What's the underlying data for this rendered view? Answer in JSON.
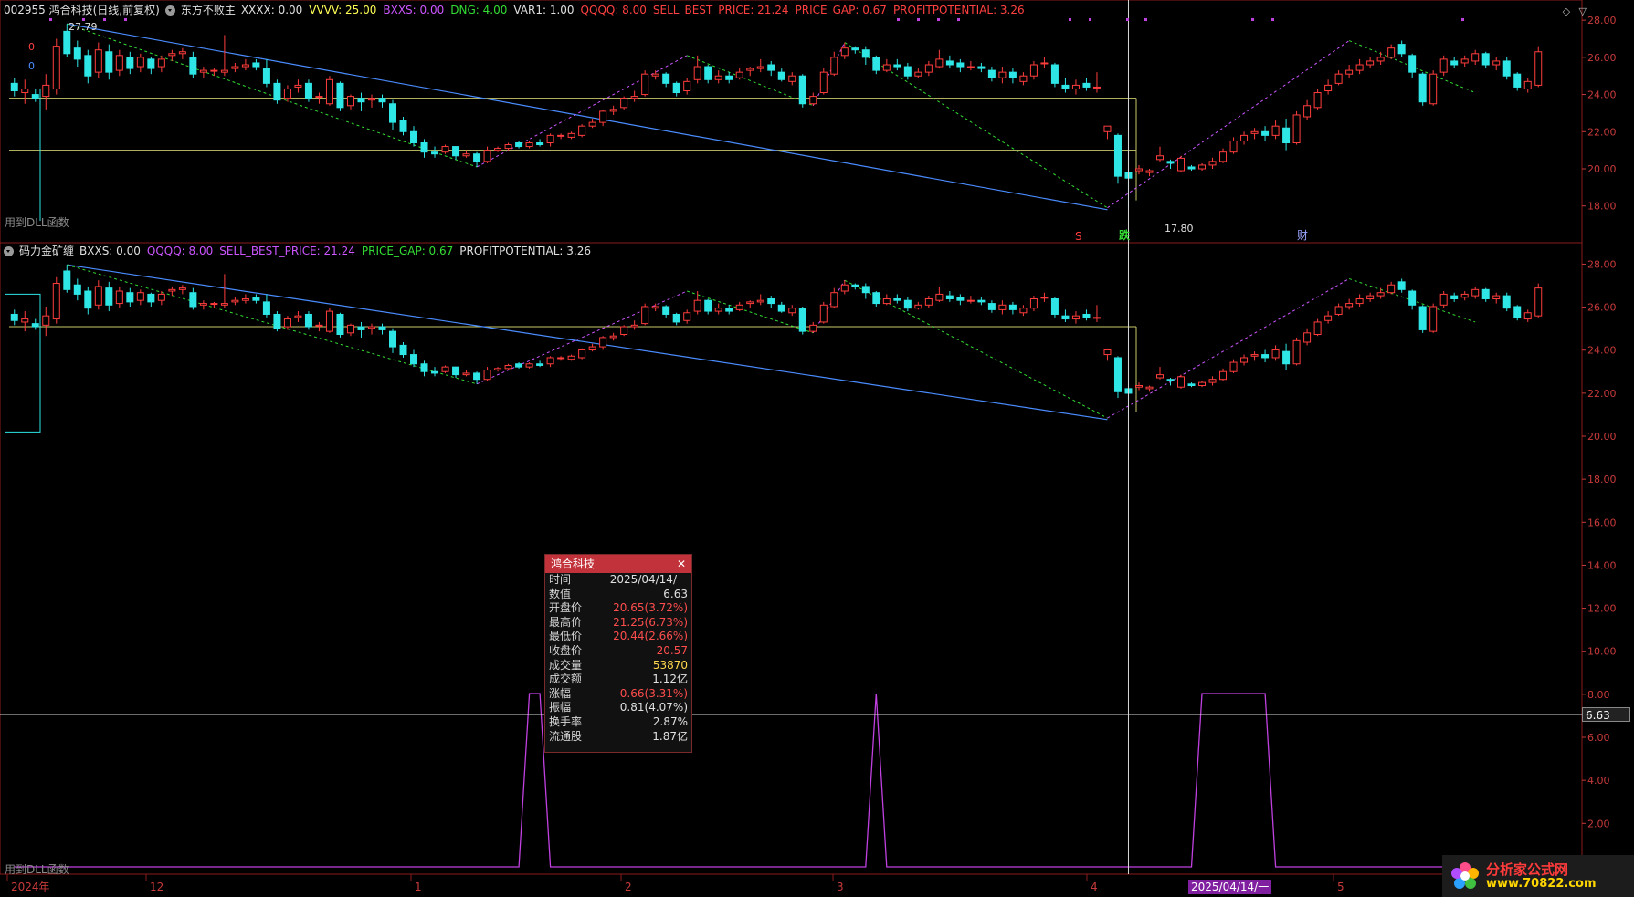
{
  "panel1": {
    "header": "002955 鸿合科技(日线,前复权)",
    "indicator_name": "东方不败主",
    "params": [
      {
        "label": "XXXX:",
        "value": "0.00",
        "color": "#e0e0e0"
      },
      {
        "label": "VVVV:",
        "value": "25.00",
        "color": "#ffff55"
      },
      {
        "label": "BXXS:",
        "value": "0.00",
        "color": "#cc55ff"
      },
      {
        "label": "DNG:",
        "value": "4.00",
        "color": "#33dd33"
      },
      {
        "label": "VAR1:",
        "value": "1.00",
        "color": "#e0e0e0"
      },
      {
        "label": "QQQQ:",
        "value": "8.00",
        "color": "#ff4040"
      },
      {
        "label": "SELL_BEST_PRICE:",
        "value": "21.24",
        "color": "#ff4040"
      },
      {
        "label": "PRICE_GAP:",
        "value": "0.67",
        "color": "#ff4040"
      },
      {
        "label": "PROFITPOTENTIAL:",
        "value": "3.26",
        "color": "#ff4040"
      }
    ],
    "high_label": "27.79",
    "low_label": "17.80",
    "zero_labels": [
      "0",
      "0"
    ],
    "dll_text": "用到DLL函数",
    "marker_s": "S",
    "marker_die": "跌",
    "marker_cai": "财",
    "tool_icons": [
      "◇",
      "▽"
    ],
    "y_labels": [
      "28.00",
      "26.00",
      "24.00",
      "22.00",
      "20.00",
      "18.00"
    ]
  },
  "panel2": {
    "indicator_name": "码力金矿缠",
    "params": [
      {
        "label": "BXXS:",
        "value": "0.00",
        "color": "#e0e0e0"
      },
      {
        "label": "QQQQ:",
        "value": "8.00",
        "color": "#cc55ff"
      },
      {
        "label": "SELL_BEST_PRICE:",
        "value": "21.24",
        "color": "#cc55ff"
      },
      {
        "label": "PRICE_GAP:",
        "value": "0.67",
        "color": "#33dd33"
      },
      {
        "label": "PROFITPOTENTIAL:",
        "value": "3.26",
        "color": "#e0e0e0"
      }
    ],
    "y_labels": [
      "28.00",
      "26.00",
      "24.00",
      "22.00",
      "20.00",
      "18.00",
      "16.00",
      "14.00",
      "12.00",
      "10.00",
      "8.00",
      "6.00",
      "4.00",
      "2.00"
    ],
    "dll_text": "用到DLL函数",
    "cursor_value": "6.63"
  },
  "x_axis": {
    "labels": [
      "2024年",
      "12",
      "1",
      "2",
      "3",
      "4",
      "5"
    ],
    "cursor_date": "2025/04/14/一"
  },
  "tooltip": {
    "title": "鸿合科技",
    "rows": [
      {
        "k": "时间",
        "v": "2025/04/14/一",
        "c": "#e0e0e0"
      },
      {
        "k": "数值",
        "v": "6.63",
        "c": "#e0e0e0"
      },
      {
        "k": "开盘价",
        "v": "20.65(3.72%)",
        "c": "#ff4d4d"
      },
      {
        "k": "最高价",
        "v": "21.25(6.73%)",
        "c": "#ff4d4d"
      },
      {
        "k": "最低价",
        "v": "20.44(2.66%)",
        "c": "#ff4d4d"
      },
      {
        "k": "收盘价",
        "v": "20.57",
        "c": "#ff4d4d"
      },
      {
        "k": "成交量",
        "v": "53870",
        "c": "#ffd84d"
      },
      {
        "k": "成交额",
        "v": "1.12亿",
        "c": "#e0e0e0"
      },
      {
        "k": "涨幅",
        "v": "0.66(3.31%)",
        "c": "#ff4d4d"
      },
      {
        "k": "振幅",
        "v": "0.81(4.07%)",
        "c": "#e0e0e0"
      },
      {
        "k": "换手率",
        "v": "2.87%",
        "c": "#e0e0e0"
      },
      {
        "k": "流通股",
        "v": "1.87亿",
        "c": "#e0e0e0"
      }
    ]
  },
  "logo": {
    "title": "分析家公式网",
    "url": "www.70822.com"
  },
  "chart_data": {
    "type": "candlestick",
    "price_range": [
      17.2,
      28.4
    ],
    "indicator_range": [
      0,
      8
    ],
    "candles": [
      [
        24.6,
        24.2,
        24.9,
        23.9
      ],
      [
        24.1,
        24.3,
        24.8,
        23.5
      ],
      [
        24.0,
        23.8,
        24.3,
        23.6
      ],
      [
        23.9,
        24.5,
        25.1,
        23.2
      ],
      [
        24.3,
        26.6,
        27.0,
        24.0
      ],
      [
        27.4,
        26.2,
        27.8,
        26.0
      ],
      [
        26.5,
        25.9,
        26.9,
        25.5
      ],
      [
        26.1,
        25.0,
        26.4,
        24.6
      ],
      [
        25.2,
        26.4,
        26.8,
        24.9
      ],
      [
        26.3,
        25.2,
        26.7,
        24.8
      ],
      [
        25.3,
        26.1,
        26.4,
        25.0
      ],
      [
        26.0,
        25.4,
        26.3,
        25.1
      ],
      [
        25.5,
        26.0,
        26.2,
        25.2
      ],
      [
        25.9,
        25.4,
        26.0,
        25.1
      ],
      [
        25.5,
        25.9,
        26.1,
        25.2
      ],
      [
        26.1,
        26.2,
        26.4,
        25.8
      ],
      [
        26.2,
        26.3,
        26.5,
        25.9
      ],
      [
        26.0,
        25.1,
        26.3,
        24.9
      ],
      [
        25.2,
        25.3,
        25.5,
        24.9
      ],
      [
        25.3,
        25.3,
        25.4,
        25.0
      ],
      [
        25.2,
        25.3,
        27.2,
        25.0
      ],
      [
        25.4,
        25.5,
        25.7,
        25.2
      ],
      [
        25.5,
        25.6,
        25.9,
        25.3
      ],
      [
        25.7,
        25.5,
        25.9,
        25.3
      ],
      [
        25.4,
        24.6,
        25.9,
        24.4
      ],
      [
        24.6,
        23.7,
        24.8,
        23.5
      ],
      [
        23.8,
        24.3,
        24.5,
        23.6
      ],
      [
        24.4,
        24.5,
        24.8,
        24.1
      ],
      [
        24.6,
        23.8,
        24.8,
        23.6
      ],
      [
        23.9,
        23.9,
        24.1,
        23.5
      ],
      [
        23.5,
        24.8,
        25.0,
        23.4
      ],
      [
        24.6,
        23.3,
        24.7,
        23.1
      ],
      [
        23.4,
        23.9,
        24.0,
        23.2
      ],
      [
        23.8,
        23.6,
        24.1,
        23.1
      ],
      [
        23.7,
        23.8,
        24.0,
        23.3
      ],
      [
        23.8,
        23.6,
        24.0,
        23.3
      ],
      [
        23.5,
        22.5,
        23.7,
        22.1
      ],
      [
        22.6,
        22.0,
        22.8,
        21.8
      ],
      [
        22.0,
        21.4,
        22.3,
        21.2
      ],
      [
        21.4,
        20.9,
        21.6,
        20.6
      ],
      [
        20.9,
        20.8,
        21.2,
        20.6
      ],
      [
        20.9,
        21.2,
        21.3,
        20.8
      ],
      [
        21.2,
        20.7,
        21.2,
        20.5
      ],
      [
        20.7,
        20.8,
        21.0,
        20.6
      ],
      [
        20.8,
        20.4,
        20.9,
        20.1
      ],
      [
        20.4,
        21.0,
        21.2,
        20.3
      ],
      [
        21.0,
        21.1,
        21.2,
        20.9
      ],
      [
        21.1,
        21.3,
        21.4,
        21.0
      ],
      [
        21.4,
        21.2,
        21.5,
        21.1
      ],
      [
        21.2,
        21.4,
        21.5,
        21.1
      ],
      [
        21.4,
        21.3,
        21.6,
        21.2
      ],
      [
        21.4,
        21.8,
        21.9,
        21.2
      ],
      [
        21.8,
        21.8,
        21.9,
        21.6
      ],
      [
        21.7,
        21.9,
        22.0,
        21.6
      ],
      [
        21.8,
        22.3,
        22.4,
        21.7
      ],
      [
        22.3,
        22.5,
        22.7,
        22.2
      ],
      [
        22.5,
        23.1,
        23.2,
        22.3
      ],
      [
        23.1,
        23.2,
        23.4,
        22.9
      ],
      [
        23.3,
        23.8,
        23.9,
        23.2
      ],
      [
        23.8,
        23.9,
        24.2,
        23.6
      ],
      [
        24.0,
        25.1,
        25.3,
        23.9
      ],
      [
        25.0,
        25.1,
        25.3,
        24.8
      ],
      [
        25.1,
        24.6,
        25.2,
        24.4
      ],
      [
        24.6,
        24.1,
        24.7,
        23.9
      ],
      [
        24.2,
        24.7,
        24.9,
        24.0
      ],
      [
        24.8,
        25.5,
        26.1,
        24.6
      ],
      [
        25.5,
        24.8,
        25.6,
        24.6
      ],
      [
        24.8,
        25.0,
        25.3,
        24.6
      ],
      [
        25.0,
        24.8,
        25.2,
        24.6
      ],
      [
        24.9,
        25.2,
        25.4,
        24.8
      ],
      [
        25.3,
        25.4,
        25.5,
        25.0
      ],
      [
        25.4,
        25.5,
        25.9,
        25.2
      ],
      [
        25.6,
        25.3,
        25.8,
        25.0
      ],
      [
        25.2,
        24.8,
        25.4,
        24.7
      ],
      [
        24.7,
        25.0,
        25.2,
        24.5
      ],
      [
        25.0,
        23.5,
        25.1,
        23.3
      ],
      [
        23.5,
        23.9,
        24.1,
        23.4
      ],
      [
        24.1,
        25.2,
        25.4,
        24.0
      ],
      [
        25.1,
        26.0,
        26.3,
        25.0
      ],
      [
        26.1,
        26.5,
        26.8,
        25.9
      ],
      [
        26.5,
        26.4,
        26.6,
        26.2
      ],
      [
        26.4,
        26.0,
        26.6,
        25.6
      ],
      [
        26.0,
        25.3,
        26.1,
        25.1
      ],
      [
        25.3,
        25.6,
        25.9,
        25.2
      ],
      [
        25.6,
        25.5,
        25.9,
        25.3
      ],
      [
        25.5,
        25.0,
        25.7,
        24.8
      ],
      [
        25.0,
        25.2,
        25.4,
        24.9
      ],
      [
        25.2,
        25.6,
        25.8,
        25.0
      ],
      [
        25.5,
        25.9,
        26.4,
        25.4
      ],
      [
        25.8,
        25.6,
        26.1,
        25.4
      ],
      [
        25.7,
        25.5,
        25.9,
        25.2
      ],
      [
        25.5,
        25.5,
        25.8,
        25.3
      ],
      [
        25.5,
        25.4,
        25.7,
        25.2
      ],
      [
        25.3,
        24.9,
        25.5,
        24.7
      ],
      [
        24.9,
        25.2,
        25.5,
        24.6
      ],
      [
        25.2,
        24.9,
        25.4,
        24.6
      ],
      [
        24.7,
        25.0,
        25.2,
        24.5
      ],
      [
        25.0,
        25.6,
        25.8,
        24.8
      ],
      [
        25.7,
        25.7,
        26.0,
        25.4
      ],
      [
        25.6,
        24.6,
        25.7,
        24.4
      ],
      [
        24.5,
        24.3,
        24.9,
        24.1
      ],
      [
        24.3,
        24.5,
        24.8,
        24.0
      ],
      [
        24.6,
        24.4,
        24.9,
        24.2
      ],
      [
        24.4,
        24.4,
        25.2,
        24.1
      ],
      [
        22.0,
        22.3,
        22.3,
        21.6
      ],
      [
        21.8,
        19.6,
        21.9,
        19.2
      ],
      [
        19.8,
        19.5,
        20.0,
        17.9
      ],
      [
        19.9,
        20.0,
        20.2,
        19.7
      ],
      [
        19.8,
        19.9,
        20.0,
        19.6
      ],
      [
        20.5,
        20.7,
        21.2,
        20.4
      ],
      [
        20.4,
        20.3,
        20.5,
        20.0
      ],
      [
        19.9,
        20.57,
        20.7,
        19.8
      ],
      [
        20.1,
        20.0,
        20.2,
        19.9
      ],
      [
        20.0,
        20.2,
        20.3,
        19.9
      ],
      [
        20.2,
        20.4,
        20.6,
        20.0
      ],
      [
        20.4,
        20.9,
        21.1,
        20.3
      ],
      [
        20.9,
        21.5,
        21.7,
        20.8
      ],
      [
        21.5,
        21.8,
        22.0,
        21.3
      ],
      [
        21.9,
        22.0,
        22.2,
        21.6
      ],
      [
        22.0,
        21.8,
        22.3,
        21.5
      ],
      [
        21.8,
        22.3,
        22.6,
        21.6
      ],
      [
        22.2,
        21.4,
        22.7,
        21.0
      ],
      [
        21.4,
        22.9,
        23.1,
        21.3
      ],
      [
        22.8,
        23.4,
        23.7,
        22.6
      ],
      [
        23.3,
        24.1,
        24.3,
        23.2
      ],
      [
        24.2,
        24.5,
        24.8,
        24.0
      ],
      [
        24.6,
        25.1,
        25.3,
        24.5
      ],
      [
        25.1,
        25.3,
        25.6,
        24.9
      ],
      [
        25.3,
        25.6,
        25.9,
        25.1
      ],
      [
        25.6,
        25.8,
        26.0,
        25.4
      ],
      [
        25.8,
        26.0,
        26.3,
        25.6
      ],
      [
        26.0,
        26.5,
        26.7,
        25.9
      ],
      [
        26.7,
        26.2,
        26.9,
        26.0
      ],
      [
        26.1,
        25.2,
        26.2,
        24.9
      ],
      [
        25.1,
        23.6,
        25.2,
        23.4
      ],
      [
        23.5,
        25.1,
        25.3,
        23.4
      ],
      [
        25.2,
        25.9,
        26.1,
        25.0
      ],
      [
        25.8,
        25.6,
        26.0,
        25.4
      ],
      [
        25.7,
        25.9,
        26.1,
        25.5
      ],
      [
        25.8,
        26.2,
        26.4,
        25.6
      ],
      [
        26.2,
        25.6,
        26.3,
        25.4
      ],
      [
        25.6,
        25.8,
        26.0,
        25.3
      ],
      [
        25.8,
        25.0,
        26.0,
        24.8
      ],
      [
        25.1,
        24.4,
        25.2,
        24.2
      ],
      [
        24.3,
        24.7,
        24.9,
        24.1
      ],
      [
        24.5,
        26.3,
        26.6,
        24.4
      ]
    ],
    "indicator": [
      0,
      0,
      0,
      0,
      0,
      0,
      0,
      0,
      0,
      0,
      0,
      0,
      0,
      0,
      0,
      0,
      0,
      0,
      0,
      0,
      0,
      0,
      0,
      0,
      0,
      0,
      0,
      0,
      0,
      0,
      0,
      0,
      0,
      0,
      0,
      0,
      0,
      0,
      0,
      0,
      0,
      0,
      0,
      0,
      0,
      0,
      0,
      0,
      0,
      8,
      8,
      0,
      0,
      0,
      0,
      0,
      0,
      0,
      0,
      0,
      0,
      0,
      0,
      0,
      0,
      0,
      0,
      0,
      0,
      0,
      0,
      0,
      0,
      0,
      0,
      0,
      0,
      0,
      0,
      0,
      0,
      0,
      8,
      0,
      0,
      0,
      0,
      0,
      0,
      0,
      0,
      0,
      0,
      0,
      0,
      0,
      0,
      0,
      0,
      0,
      0,
      0,
      0,
      0,
      0,
      0,
      0,
      0,
      0,
      0,
      0,
      0,
      0,
      8,
      8,
      8,
      8,
      8,
      8,
      8,
      0,
      0,
      0,
      0,
      0,
      0,
      0,
      0,
      0,
      0,
      0,
      0,
      0,
      0,
      0,
      0,
      0,
      0,
      0,
      0,
      0,
      0,
      0,
      0,
      0,
      0,
      0,
      0,
      0,
      0
    ],
    "support_lines": [
      23.8,
      21.0
    ],
    "cursor_index": 106
  }
}
